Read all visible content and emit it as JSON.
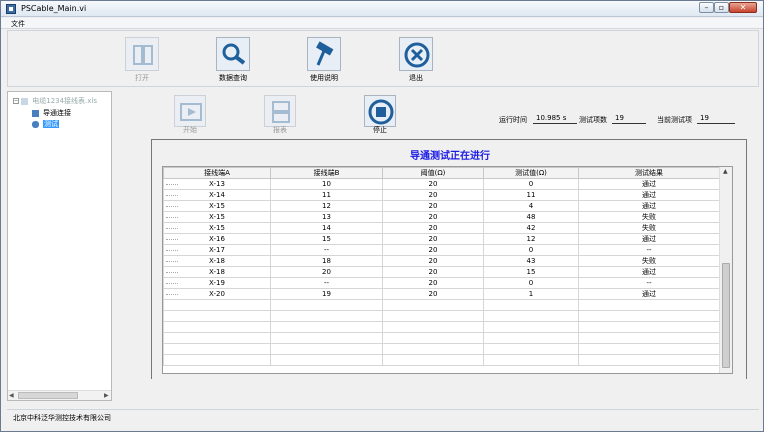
{
  "window": {
    "title": "PSCable_Main.vi"
  },
  "menu": {
    "file": "文件"
  },
  "toolbar": [
    {
      "label": "打开",
      "icon": "book-icon",
      "enabled": false
    },
    {
      "label": "数据查询",
      "icon": "magnifier-icon",
      "enabled": true
    },
    {
      "label": "使用说明",
      "icon": "hammer-icon",
      "enabled": true
    },
    {
      "label": "退出",
      "icon": "close-circle-icon",
      "enabled": true
    }
  ],
  "tree": {
    "root": "电缆1234接线表.xls",
    "children": [
      "导通连接",
      "测试"
    ]
  },
  "sub_toolbar": [
    {
      "label": "开始",
      "icon": "play-icon",
      "enabled": false
    },
    {
      "label": "报表",
      "icon": "drawer-icon",
      "enabled": false
    },
    {
      "label": "停止",
      "icon": "stop-icon",
      "enabled": true
    }
  ],
  "run": {
    "time_label": "运行时间",
    "time_value": "10.985 s",
    "count_label": "测试项数",
    "count_value": "19",
    "current_label": "当前测试项",
    "current_value": "19"
  },
  "panel": {
    "title": "导通测试正在进行"
  },
  "table": {
    "headers": [
      "接线端A",
      "接线端B",
      "阈值(Ω)",
      "测试值(Ω)",
      "测试结果"
    ],
    "rows": [
      [
        "X-13",
        "10",
        "20",
        "0",
        "通过"
      ],
      [
        "X-14",
        "11",
        "20",
        "11",
        "通过"
      ],
      [
        "X-15",
        "12",
        "20",
        "4",
        "通过"
      ],
      [
        "X-15",
        "13",
        "20",
        "48",
        "失败"
      ],
      [
        "X-15",
        "14",
        "20",
        "42",
        "失败"
      ],
      [
        "X-16",
        "15",
        "20",
        "12",
        "通过"
      ],
      [
        "X-17",
        "--",
        "20",
        "0",
        "--"
      ],
      [
        "X-18",
        "18",
        "20",
        "43",
        "失败"
      ],
      [
        "X-18",
        "20",
        "20",
        "15",
        "通过"
      ],
      [
        "X-19",
        "--",
        "20",
        "0",
        "--"
      ],
      [
        "X-20",
        "19",
        "20",
        "1",
        "通过"
      ]
    ]
  },
  "status": {
    "company": "北京中科泛华测控技术有限公司"
  }
}
